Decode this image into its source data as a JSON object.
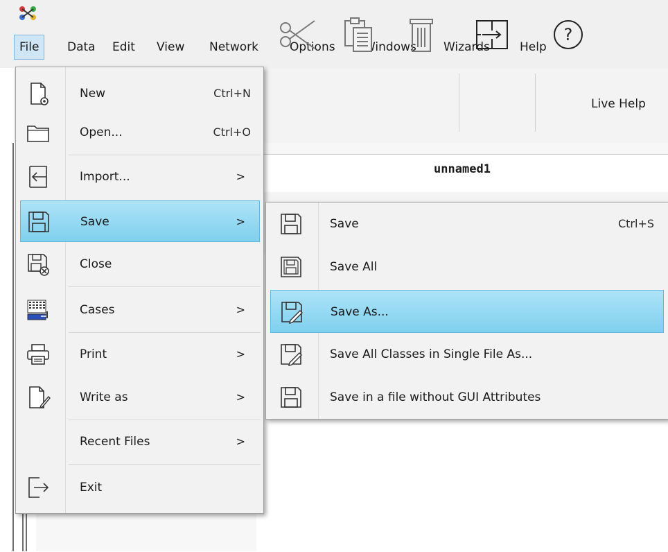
{
  "menubar": {
    "items": [
      "File",
      "Data",
      "Edit",
      "View",
      "Network",
      "Options",
      "Windows",
      "Wizards",
      "Help"
    ]
  },
  "toolbar": {
    "help_label": "Live Help"
  },
  "document": {
    "title": "unnamed1"
  },
  "file_menu": {
    "items": [
      {
        "label": "New",
        "shortcut": "Ctrl+N",
        "icon": "new-file-icon"
      },
      {
        "label": "Open...",
        "shortcut": "Ctrl+O",
        "icon": "folder-icon"
      },
      {
        "label": "Import...",
        "submenu": ">",
        "icon": "import-icon"
      },
      {
        "label": "Save",
        "submenu": ">",
        "icon": "save-icon"
      },
      {
        "label": "Close",
        "icon": "close-file-icon"
      },
      {
        "label": "Cases",
        "submenu": ">",
        "icon": "cases-icon"
      },
      {
        "label": "Print",
        "submenu": ">",
        "icon": "printer-icon"
      },
      {
        "label": "Write as",
        "submenu": ">",
        "icon": "write-as-icon"
      },
      {
        "label": "Recent Files",
        "submenu": ">"
      },
      {
        "label": "Exit",
        "icon": "exit-icon"
      }
    ]
  },
  "save_menu": {
    "items": [
      {
        "label": "Save",
        "shortcut": "Ctrl+S",
        "icon": "save-icon"
      },
      {
        "label": "Save All",
        "icon": "save-all-icon"
      },
      {
        "label": "Save As...",
        "icon": "save-as-icon"
      },
      {
        "label": "Save All Classes in Single File As...",
        "icon": "save-as-icon"
      },
      {
        "label": "Save in a file without GUI Attributes",
        "icon": "save-icon"
      }
    ]
  },
  "colors": {
    "highlight": "#8fd6f1",
    "menu_bg": "#f2f2f2"
  }
}
